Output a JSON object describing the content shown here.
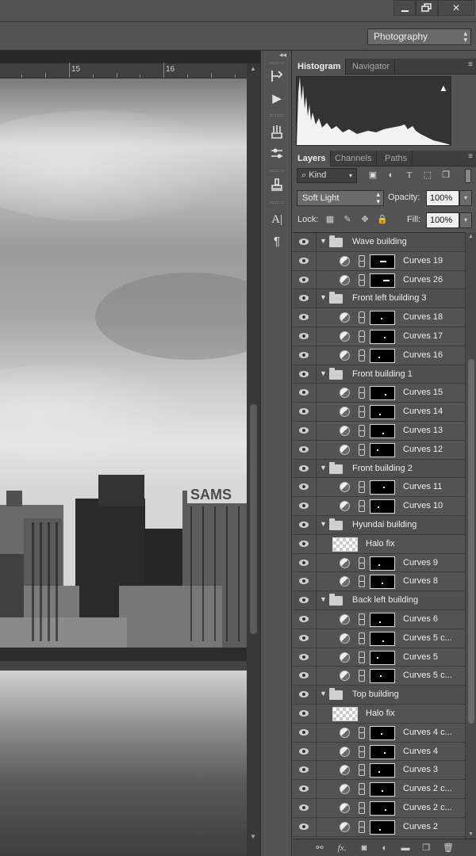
{
  "window": {
    "minimize_icon": "minimize-icon",
    "restore_icon": "restore-icon",
    "close_label": "✕"
  },
  "workspace": {
    "selected": "Photography"
  },
  "ruler": {
    "marks": [
      "15",
      "16"
    ]
  },
  "panels": {
    "top_tabs": [
      "Histogram",
      "Navigator"
    ],
    "layer_tabs": [
      "Layers",
      "Channels",
      "Paths"
    ]
  },
  "layers_panel": {
    "filter_kind": "Kind",
    "blend_mode": "Soft Light",
    "opacity_label": "Opacity:",
    "opacity_value": "100%",
    "lock_label": "Lock:",
    "fill_label": "Fill:",
    "fill_value": "100%"
  },
  "layers": [
    {
      "type": "group",
      "name": "Wave building"
    },
    {
      "type": "curves",
      "name": "Curves 19"
    },
    {
      "type": "curves",
      "name": "Curves 26"
    },
    {
      "type": "group",
      "name": "Front left building 3"
    },
    {
      "type": "curves",
      "name": "Curves 18"
    },
    {
      "type": "curves",
      "name": "Curves 17"
    },
    {
      "type": "curves",
      "name": "Curves 16"
    },
    {
      "type": "group",
      "name": "Front building 1"
    },
    {
      "type": "curves",
      "name": "Curves 15"
    },
    {
      "type": "curves",
      "name": "Curves 14"
    },
    {
      "type": "curves",
      "name": "Curves 13"
    },
    {
      "type": "curves",
      "name": "Curves 12"
    },
    {
      "type": "group",
      "name": "Front building 2"
    },
    {
      "type": "curves",
      "name": "Curves 11"
    },
    {
      "type": "curves",
      "name": "Curves 10"
    },
    {
      "type": "group",
      "name": "Hyundai building"
    },
    {
      "type": "pixel",
      "name": "Halo fix"
    },
    {
      "type": "curves",
      "name": "Curves 9"
    },
    {
      "type": "curves",
      "name": "Curves 8"
    },
    {
      "type": "group",
      "name": "Back left building"
    },
    {
      "type": "curves",
      "name": "Curves 6"
    },
    {
      "type": "curves",
      "name": "Curves 5 c..."
    },
    {
      "type": "curves",
      "name": "Curves 5"
    },
    {
      "type": "curves",
      "name": "Curves 5 c..."
    },
    {
      "type": "group",
      "name": "Top building"
    },
    {
      "type": "pixel",
      "name": "Halo fix"
    },
    {
      "type": "curves",
      "name": "Curves 4 c..."
    },
    {
      "type": "curves",
      "name": "Curves 4"
    },
    {
      "type": "curves",
      "name": "Curves 3"
    },
    {
      "type": "curves",
      "name": "Curves 2 c..."
    },
    {
      "type": "curves",
      "name": "Curves 2 c..."
    },
    {
      "type": "curves",
      "name": "Curves 2"
    }
  ],
  "photo": {
    "billboard_text": "SAMS"
  },
  "footer_icons": [
    "link-icon",
    "fx-icon",
    "mask-icon",
    "adjustment-icon",
    "folder-icon",
    "new-layer-icon",
    "trash-icon"
  ]
}
